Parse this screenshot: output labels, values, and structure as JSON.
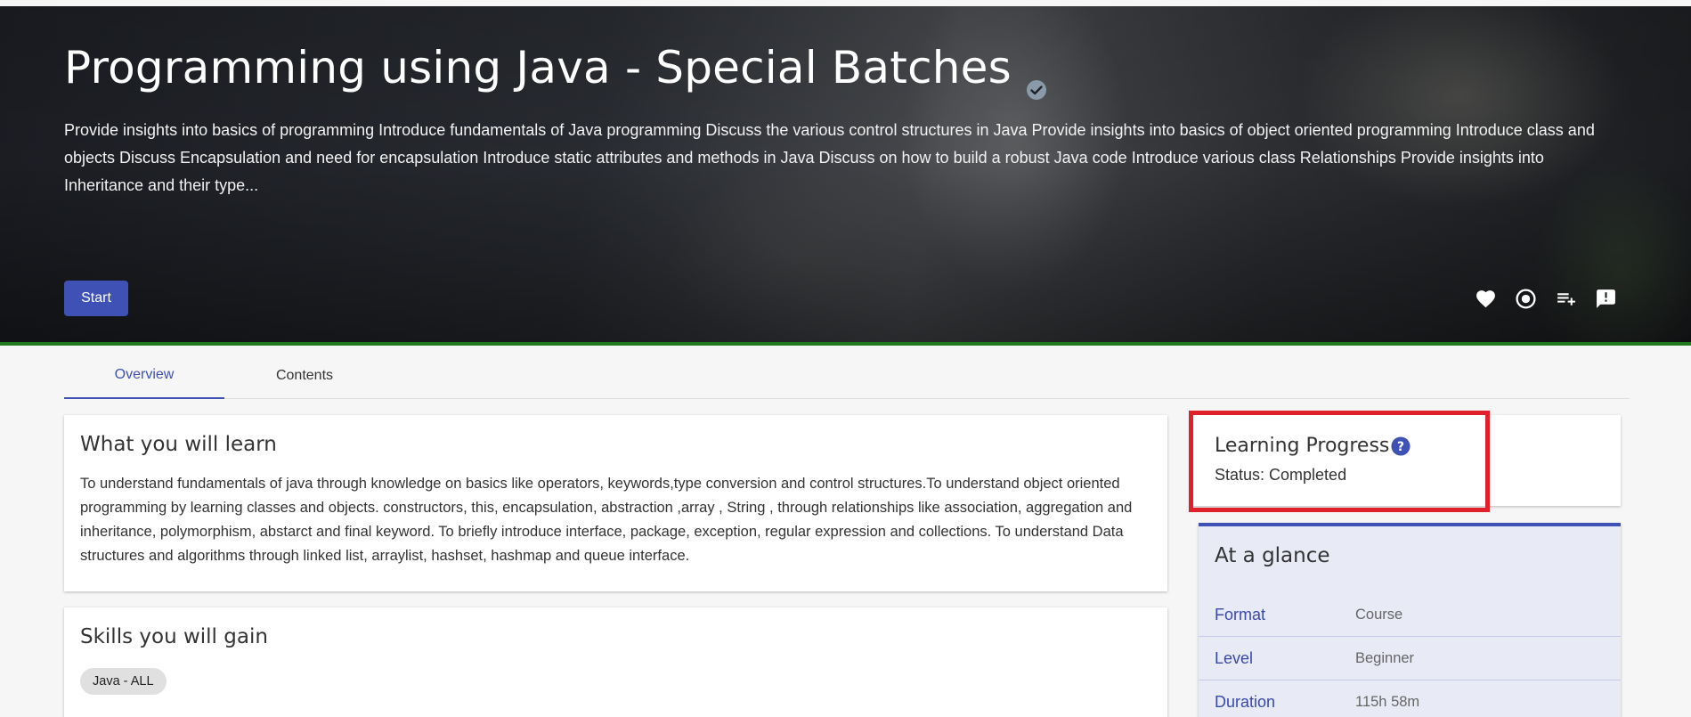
{
  "hero": {
    "title": "Programming using Java - Special Batches",
    "description": "Provide insights into basics of programming Introduce fundamentals of Java programming Discuss the various control structures in Java Provide insights into basics of object oriented programming Introduce class and objects Discuss Encapsulation and need for encapsulation Introduce static attributes and methods in Java Discuss on how to build a robust Java code Introduce various class Relationships Provide insights into Inheritance and their type...",
    "start_label": "Start",
    "actions": [
      "heart-icon",
      "target-icon",
      "playlist-add-icon",
      "feedback-icon"
    ]
  },
  "tabs": [
    {
      "label": "Overview",
      "active": true
    },
    {
      "label": "Contents",
      "active": false
    }
  ],
  "learn": {
    "title": "What you will learn",
    "text": "To understand fundamentals of java through knowledge on basics like operators, keywords,type conversion and control structures.To understand object oriented programming by learning classes and objects. constructors, this, encapsulation, abstraction ,array , String , through relationships like association, aggregation and inheritance, polymorphism, abstarct and final keyword. To briefly introduce interface, package, exception, regular expression and collections. To understand Data structures and algorithms through linked list, arraylist, hashset, hashmap and queue interface."
  },
  "skills": {
    "title": "Skills you will gain",
    "items": [
      "Java - ALL"
    ]
  },
  "progress": {
    "title": "Learning Progress",
    "status": "Status: Completed"
  },
  "glance": {
    "title": "At a glance",
    "rows": [
      {
        "key": "Format",
        "value": "Course"
      },
      {
        "key": "Level",
        "value": "Beginner"
      },
      {
        "key": "Duration",
        "value": "115h 58m"
      }
    ]
  },
  "colors": {
    "accent": "#3f51b5",
    "highlight": "#e0202a",
    "hero_underline": "#1f7a1f"
  }
}
